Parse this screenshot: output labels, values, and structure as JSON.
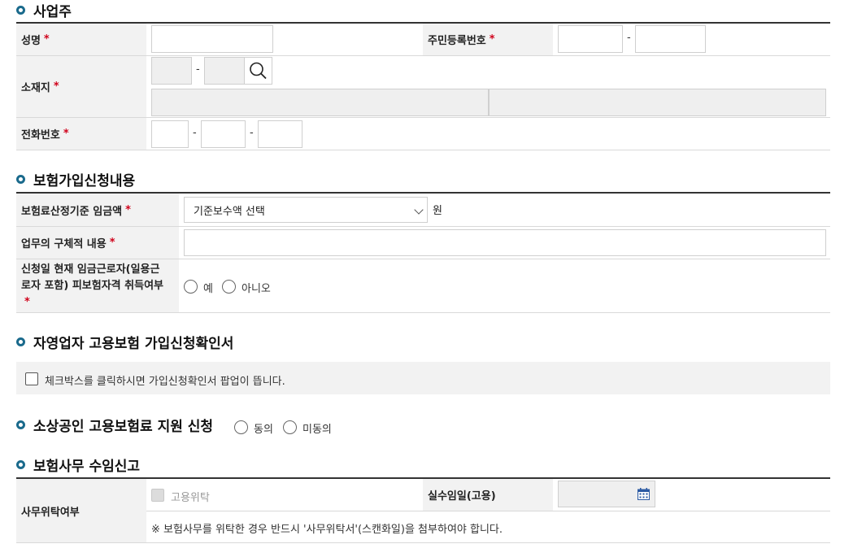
{
  "required_mark": "*",
  "owner": {
    "title": "사업주",
    "name_label": "성명",
    "rrn_label": "주민등록번호",
    "address_label": "소재지",
    "phone_label": "전화번호",
    "dash": "-"
  },
  "insurance": {
    "title": "보험가입신청내용",
    "wage_label": "보험료산정기준 임금액",
    "wage_select": "기준보수액 선택",
    "wage_unit": "원",
    "duty_label": "업무의 구체적 내용",
    "eligibility_label_line1": "신청일 현재 임금근로자(일용근",
    "eligibility_label_line2": "로자 포함) 피보험자격 취득여부",
    "yes_label": "예",
    "no_label": "아니오"
  },
  "confirmation": {
    "title": "자영업자 고용보험 가입신청확인서",
    "checkbox_label": "체크박스를 클릭하시면 가입신청확인서 팝업이 뜹니다."
  },
  "support": {
    "title": "소상공인 고용보험료 지원 신청",
    "agree_label": "동의",
    "disagree_label": "미동의"
  },
  "office": {
    "title": "보험사무 수임신고",
    "delegation_label": "사무위탁여부",
    "employment_delegation_label": "고용위탁",
    "date_label": "실수임일(고용)",
    "notice": "※ 보험사무를 위탁한 경우 반드시 '사무위탁서'(스캔화일)을 첨부하여야 합니다."
  },
  "colors": {
    "accent": "#1a6a8c",
    "required": "#d0021b",
    "header_bg": "#f2f2f2"
  },
  "icons": [
    "search-icon",
    "chevron-down-icon",
    "calendar-icon"
  ]
}
